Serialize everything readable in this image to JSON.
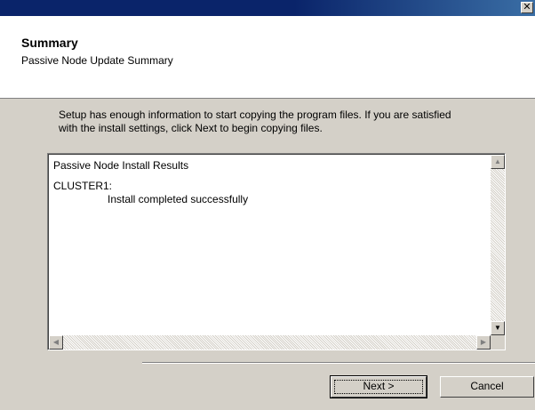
{
  "window": {
    "title": "",
    "close_glyph": "✕"
  },
  "header": {
    "title": "Summary",
    "subtitle": "Passive Node Update Summary"
  },
  "description": {
    "line1": "Setup has enough information to start copying the program files. If you are satisfied",
    "line2": "with the install settings, click Next to begin copying files."
  },
  "results": {
    "heading": "Passive Node Install Results",
    "cluster": "CLUSTER1:",
    "status": "Install completed successfully"
  },
  "buttons": {
    "next_label": "Next >",
    "cancel_label": "Cancel"
  },
  "colors": {
    "titlebar": "#0a246a",
    "dialog_face": "#d4d0c8",
    "header_bg": "#ffffff"
  }
}
